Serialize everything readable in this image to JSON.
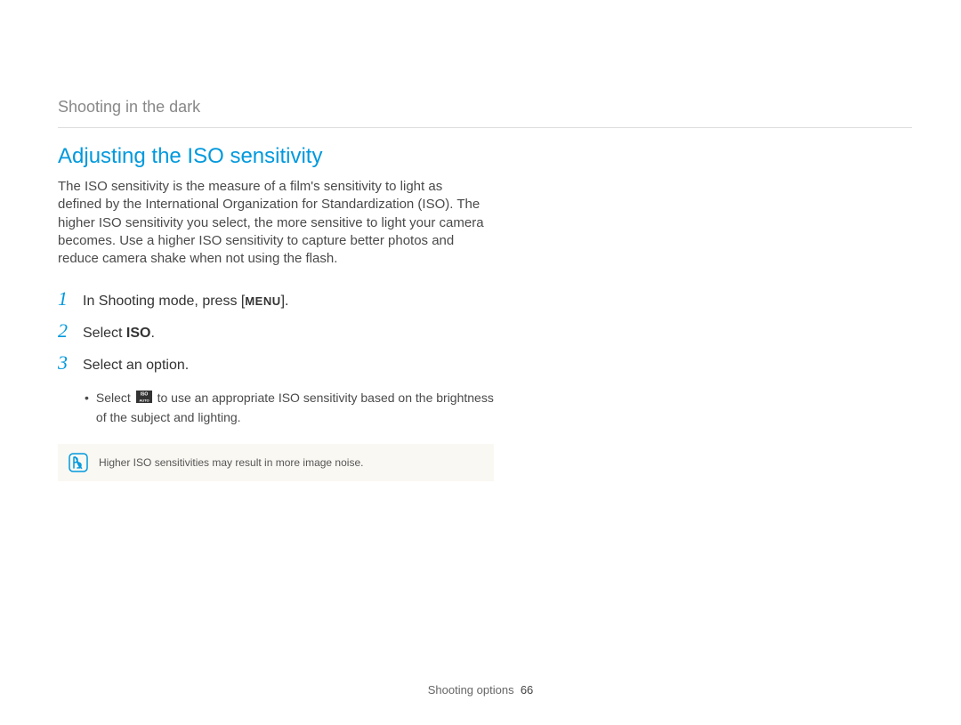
{
  "breadcrumb": "Shooting in the dark",
  "heading": "Adjusting the ISO sensitivity",
  "intro": "The ISO sensitivity is the measure of a film's sensitivity to light as defined by the International Organization for Standardization (ISO). The higher ISO sensitivity you select, the more sensitive to light your camera becomes. Use a higher ISO sensitivity to capture better photos and reduce camera shake when not using the flash.",
  "steps": {
    "s1_num": "1",
    "s1_prefix": "In Shooting mode, press [",
    "s1_menu": "MENU",
    "s1_suffix": "].",
    "s2_num": "2",
    "s2_prefix": "Select ",
    "s2_bold": "ISO",
    "s2_suffix": ".",
    "s3_num": "3",
    "s3_text": "Select an option."
  },
  "substep": {
    "prefix": "Select ",
    "suffix": " to use an appropriate ISO sensitivity based on the brightness of the subject and lighting."
  },
  "note": "Higher ISO sensitivities may result in more image noise.",
  "footer_label": "Shooting options",
  "footer_page": "66"
}
